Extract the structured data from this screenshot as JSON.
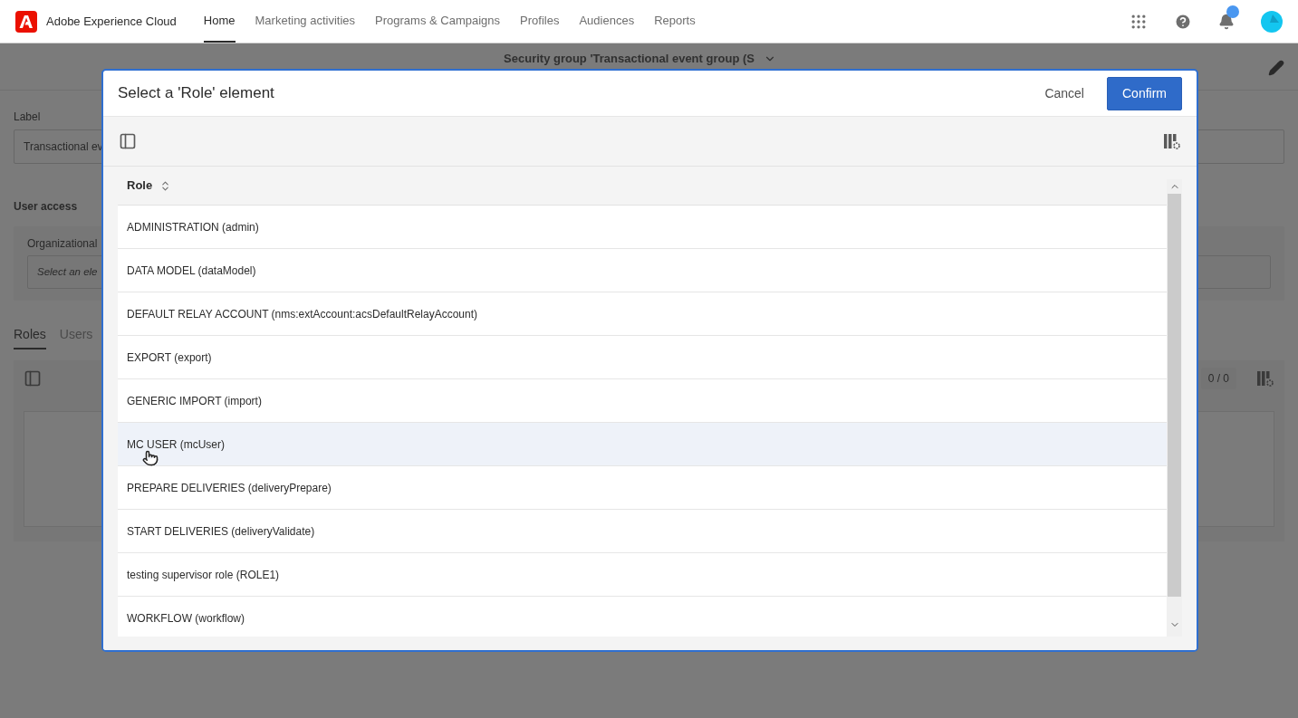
{
  "app_bar": {
    "product": "Adobe Experience Cloud",
    "nav": [
      {
        "label": "Home",
        "selected": true
      },
      {
        "label": "Marketing activities",
        "selected": false
      },
      {
        "label": "Programs & Campaigns",
        "selected": false
      },
      {
        "label": "Profiles",
        "selected": false
      },
      {
        "label": "Audiences",
        "selected": false
      },
      {
        "label": "Reports",
        "selected": false
      }
    ],
    "notifications_unread": true
  },
  "page": {
    "title": "Security group 'Transactional event group (S",
    "label_caption": "Label",
    "label_value": "Transactional ev",
    "section": "User access",
    "org_caption": "Organizational",
    "org_placeholder": "Select an ele",
    "tabs": [
      {
        "label": "Roles",
        "selected": true
      },
      {
        "label": "Users",
        "selected": false
      }
    ],
    "count": "0 / 0"
  },
  "dialog": {
    "title": "Select a 'Role' element",
    "cancel": "Cancel",
    "confirm": "Confirm",
    "column": "Role",
    "rows": [
      {
        "label": "ADMINISTRATION (admin)",
        "selected": false
      },
      {
        "label": "DATA MODEL (dataModel)",
        "selected": false
      },
      {
        "label": "DEFAULT RELAY ACCOUNT (nms:extAccount:acsDefaultRelayAccount)",
        "selected": false
      },
      {
        "label": "EXPORT (export)",
        "selected": false
      },
      {
        "label": "GENERIC IMPORT (import)",
        "selected": false
      },
      {
        "label": "MC USER (mcUser)",
        "selected": true
      },
      {
        "label": "PREPARE DELIVERIES (deliveryPrepare)",
        "selected": false
      },
      {
        "label": "START DELIVERIES (deliveryValidate)",
        "selected": false
      },
      {
        "label": "testing supervisor role (ROLE1)",
        "selected": false
      },
      {
        "label": "WORKFLOW (workflow)",
        "selected": false
      }
    ]
  }
}
